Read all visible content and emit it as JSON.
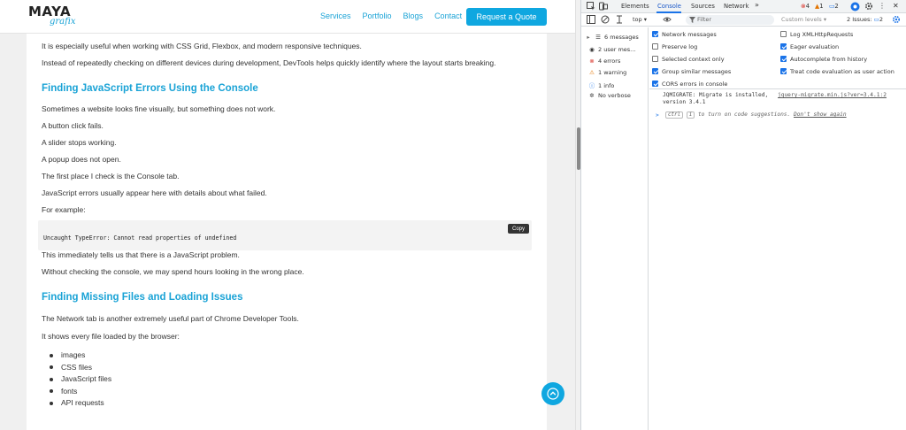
{
  "site": {
    "logo": {
      "top": "MAYA",
      "bottom": "grafix"
    },
    "nav": [
      "Services",
      "Portfolio",
      "Blogs",
      "Contact"
    ],
    "cta": "Request a Quote",
    "paragraphs_top": [
      "It is especially useful when working with CSS Grid, Flexbox, and modern responsive techniques.",
      "Instead of repeatedly checking on different devices during development, DevTools helps quickly identify where the layout starts breaking."
    ],
    "heading1": "Finding JavaScript Errors Using the Console",
    "section1": [
      "Sometimes a website looks fine visually, but something does not work.",
      "A button click fails.",
      "A slider stops working.",
      "A popup does not open.",
      "The first place I check is the Console tab.",
      "JavaScript errors usually appear here with details about what failed.",
      "For example:"
    ],
    "code": "Uncaught TypeError: Cannot read properties of undefined",
    "copy_label": "Copy",
    "after_code": [
      "This immediately tells us that there is a JavaScript problem.",
      "Without checking the console, we may spend hours looking in the wrong place."
    ],
    "heading2": "Finding Missing Files and Loading Issues",
    "section2": [
      "The Network tab is another extremely useful part of Chrome Developer Tools.",
      "It shows every file loaded by the browser:"
    ],
    "bullets": [
      "images",
      "CSS files",
      "JavaScript files",
      "fonts",
      "API requests"
    ]
  },
  "devtools": {
    "tabs": [
      "Elements",
      "Console",
      "Sources",
      "Network"
    ],
    "more_tabs": "»",
    "counters": {
      "errors": "4",
      "warnings": "1",
      "messages": "2"
    },
    "context": "top ▾",
    "filter_placeholder": "Filter",
    "levels": "Custom levels ▾",
    "issues": "2 Issues:",
    "issues_count": "2",
    "sidebar": [
      {
        "icon": "list",
        "label": "6 messages"
      },
      {
        "icon": "user",
        "label": "2 user mes…"
      },
      {
        "icon": "error",
        "label": "4 errors"
      },
      {
        "icon": "warning",
        "label": "1 warning"
      },
      {
        "icon": "info",
        "label": "1 info"
      },
      {
        "icon": "verbose",
        "label": "No verbose"
      }
    ],
    "settings_left": [
      {
        "label": "Network messages",
        "checked": true
      },
      {
        "label": "Preserve log",
        "checked": false
      },
      {
        "label": "Selected context only",
        "checked": false
      },
      {
        "label": "Group similar messages",
        "checked": true
      },
      {
        "label": "CORS errors in console",
        "checked": true
      }
    ],
    "settings_right": [
      {
        "label": "Log XMLHttpRequests",
        "checked": false
      },
      {
        "label": "Eager evaluation",
        "checked": true
      },
      {
        "label": "Autocomplete from history",
        "checked": true
      },
      {
        "label": "Treat code evaluation as user action",
        "checked": true
      }
    ],
    "log_line1": "JQMIGRATE: Migrate is installed,",
    "log_line2": "version 3.4.1",
    "log_source": "jquery-migrate.min.js?ver=3.4.1:2",
    "prompt_prefix": ">",
    "prompt_key1": "ctrl",
    "prompt_key2": "i",
    "prompt_text": "to turn on code suggestions.",
    "prompt_link": "Don't show again",
    "colors": {
      "accent": "#1aa3d6",
      "devtools_blue": "#1a73e8",
      "error": "#d93025",
      "warning": "#e37400"
    }
  }
}
